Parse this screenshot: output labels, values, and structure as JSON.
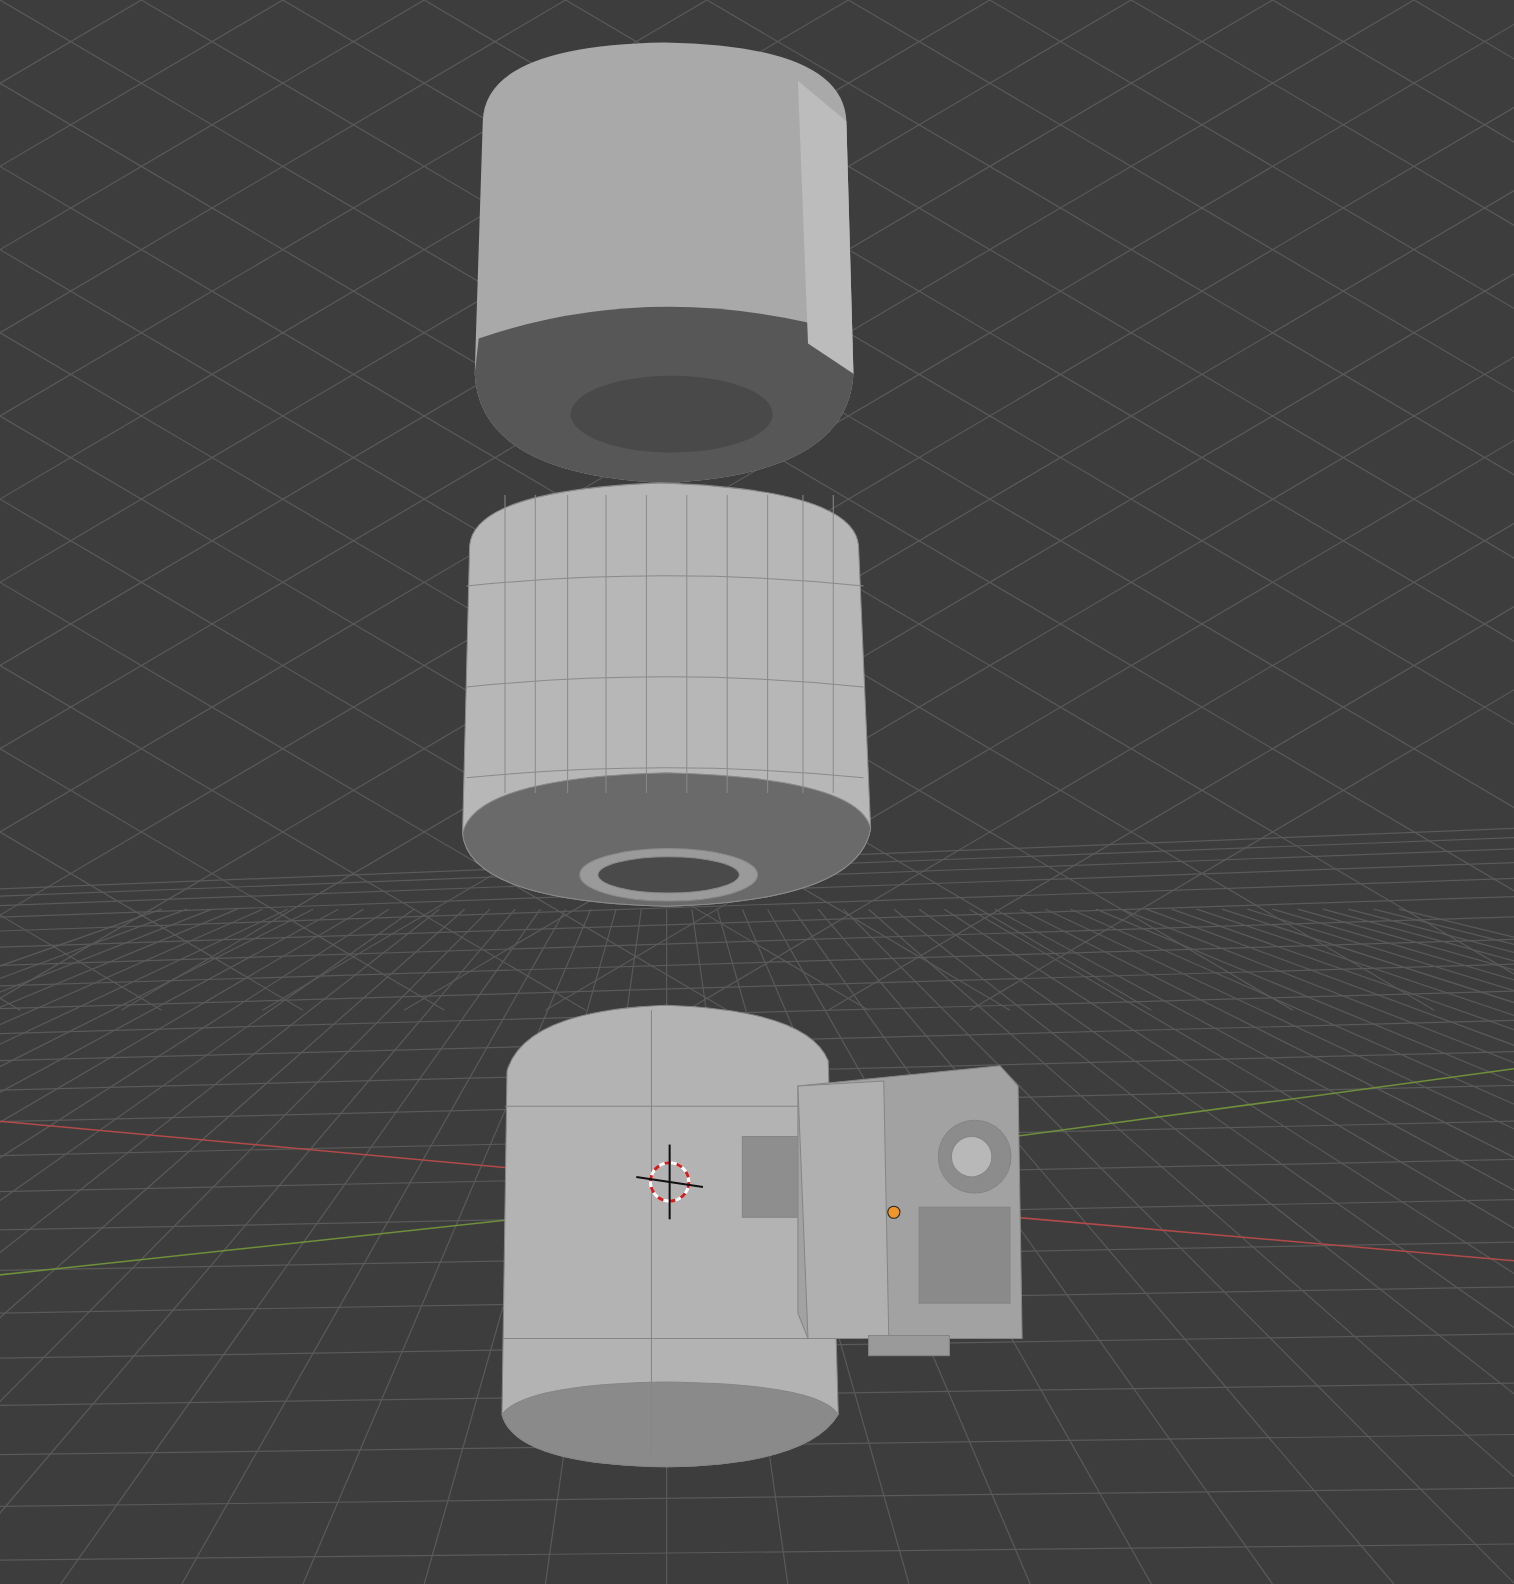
{
  "viewport": {
    "axes": [
      {
        "kind": "x",
        "color": "#b24a4a"
      },
      {
        "kind": "y",
        "color": "#6f8f3a"
      }
    ],
    "objects": [
      {
        "kind": "cap"
      },
      {
        "kind": "shell"
      },
      {
        "kind": "motor"
      }
    ]
  }
}
